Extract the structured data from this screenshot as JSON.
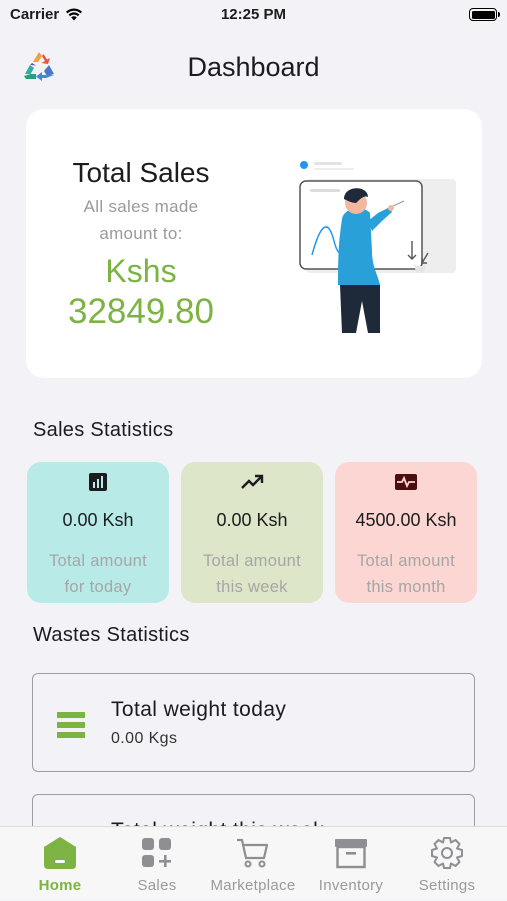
{
  "status_bar": {
    "carrier": "Carrier",
    "time": "12:25 PM"
  },
  "header": {
    "title": "Dashboard",
    "logo_icon": "recycle-triangle-logo"
  },
  "total_sales": {
    "title": "Total Sales",
    "subtitle_line1": "All sales made",
    "subtitle_line2": "amount to:",
    "currency": "Kshs",
    "amount": "32849.80",
    "illustration_icon": "presenter-whiteboard-illustration"
  },
  "sales_statistics": {
    "title": "Sales Statistics",
    "cards": [
      {
        "icon": "bar-chart-icon",
        "value": "0.00 Ksh",
        "label_line1": "Total amount",
        "label_line2": "for today",
        "bg": "#b8ebe8"
      },
      {
        "icon": "trending-up-icon",
        "value": "0.00 Ksh",
        "label_line1": "Total amount",
        "label_line2": "this week",
        "bg": "#dde6c9"
      },
      {
        "icon": "monitor-heart-icon",
        "value": "4500.00 Ksh",
        "label_line1": "Total amount",
        "label_line2": "this month",
        "bg": "#fbd6d2"
      }
    ]
  },
  "wastes_statistics": {
    "title": "Wastes Statistics",
    "cards": [
      {
        "icon": "storage-stack-icon",
        "title": "Total weight today",
        "value": "0.00 Kgs"
      },
      {
        "icon": "storage-stack-icon",
        "title": "Total weight this week"
      }
    ]
  },
  "tab_bar": {
    "accent": "#7cb342",
    "tabs": [
      {
        "label": "Home",
        "icon": "home-icon",
        "active": true
      },
      {
        "label": "Sales",
        "icon": "grid-add-icon",
        "active": false
      },
      {
        "label": "Marketplace",
        "icon": "cart-icon",
        "active": false
      },
      {
        "label": "Inventory",
        "icon": "archive-box-icon",
        "active": false
      },
      {
        "label": "Settings",
        "icon": "gear-icon",
        "active": false
      }
    ]
  }
}
